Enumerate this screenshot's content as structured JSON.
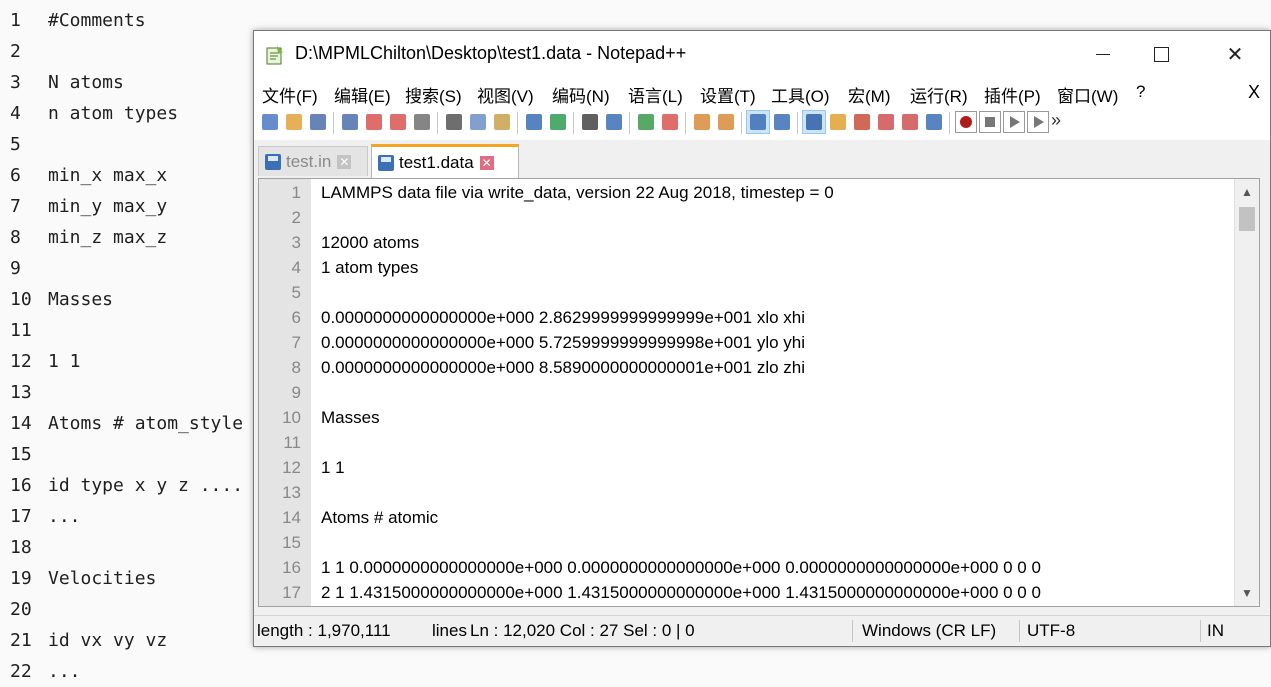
{
  "background_editor": {
    "lines": [
      {
        "num": "1",
        "text": "#Comments"
      },
      {
        "num": "2",
        "text": ""
      },
      {
        "num": "3",
        "text": "N atoms"
      },
      {
        "num": "4",
        "text": "n atom types"
      },
      {
        "num": "5",
        "text": ""
      },
      {
        "num": "6",
        "text": "min_x max_x"
      },
      {
        "num": "7",
        "text": "min_y max_y"
      },
      {
        "num": "8",
        "text": "min_z max_z"
      },
      {
        "num": "9",
        "text": ""
      },
      {
        "num": "10",
        "text": "Masses"
      },
      {
        "num": "11",
        "text": ""
      },
      {
        "num": "12",
        "text": "1 1"
      },
      {
        "num": "13",
        "text": ""
      },
      {
        "num": "14",
        "text": "Atoms # atom_style"
      },
      {
        "num": "15",
        "text": ""
      },
      {
        "num": "16",
        "text": "id type x y z ...."
      },
      {
        "num": "17",
        "text": "..."
      },
      {
        "num": "18",
        "text": ""
      },
      {
        "num": "19",
        "text": "Velocities"
      },
      {
        "num": "20",
        "text": ""
      },
      {
        "num": "21",
        "text": "id vx vy vz"
      },
      {
        "num": "22",
        "text": "..."
      }
    ]
  },
  "window": {
    "title": "D:\\MPMLChilton\\Desktop\\test1.data - Notepad++",
    "app_icon": "notepad-plus-plus-icon"
  },
  "menu": {
    "items": [
      "文件(F)",
      "编辑(E)",
      "搜索(S)",
      "视图(V)",
      "编码(N)",
      "语言(L)",
      "设置(T)",
      "工具(O)",
      "宏(M)",
      "运行(R)",
      "插件(P)",
      "窗口(W)",
      "?"
    ],
    "close_label": "X"
  },
  "toolbar": {
    "icons": [
      "new-file-icon",
      "open-file-icon",
      "save-icon",
      "save-all-icon",
      "close-icon",
      "close-all-icon",
      "print-icon",
      "cut-icon",
      "copy-icon",
      "paste-icon",
      "undo-icon",
      "redo-icon",
      "find-icon",
      "replace-icon",
      "zoom-in-icon",
      "zoom-out-icon",
      "sync-vertical-icon",
      "sync-horizontal-icon",
      "word-wrap-icon",
      "show-all-characters-icon",
      "indent-guide-icon",
      "folder-as-workspace-icon",
      "document-map-icon",
      "function-list-icon",
      "document-list-icon",
      "monitoring-icon",
      "record-macro-icon",
      "stop-record-icon",
      "play-macro-icon",
      "run-macro-multiple-icon",
      "more-icon"
    ]
  },
  "tabs": [
    {
      "label": "test.in",
      "active": false
    },
    {
      "label": "test1.data",
      "active": true
    }
  ],
  "editor": {
    "lines": [
      {
        "num": "1",
        "text": "LAMMPS data file via write_data, version 22 Aug 2018, timestep = 0"
      },
      {
        "num": "2",
        "text": ""
      },
      {
        "num": "3",
        "text": "12000 atoms"
      },
      {
        "num": "4",
        "text": "1 atom types"
      },
      {
        "num": "5",
        "text": ""
      },
      {
        "num": "6",
        "text": "0.0000000000000000e+000 2.8629999999999999e+001 xlo xhi"
      },
      {
        "num": "7",
        "text": "0.0000000000000000e+000 5.7259999999999998e+001 ylo yhi"
      },
      {
        "num": "8",
        "text": "0.0000000000000000e+000 8.5890000000000001e+001 zlo zhi"
      },
      {
        "num": "9",
        "text": ""
      },
      {
        "num": "10",
        "text": "Masses"
      },
      {
        "num": "11",
        "text": ""
      },
      {
        "num": "12",
        "text": "1 1"
      },
      {
        "num": "13",
        "text": ""
      },
      {
        "num": "14",
        "text": "Atoms # atomic"
      },
      {
        "num": "15",
        "text": ""
      },
      {
        "num": "16",
        "text": "1 1 0.0000000000000000e+000 0.0000000000000000e+000 0.0000000000000000e+000 0 0 0"
      },
      {
        "num": "17",
        "text": "2 1 1.4315000000000000e+000 1.4315000000000000e+000 1.4315000000000000e+000 0 0 0"
      }
    ]
  },
  "status": {
    "length": "length : 1,970,111",
    "lines": "lines",
    "position": "Ln : 12,020    Col : 27    Sel : 0 | 0",
    "eol": "Windows (CR LF)",
    "encoding": "UTF-8",
    "mode": "IN"
  }
}
